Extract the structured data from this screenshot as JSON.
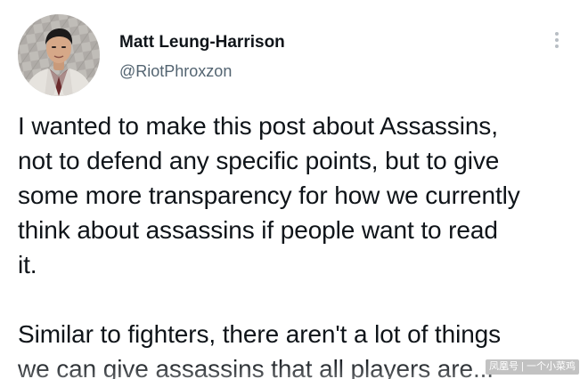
{
  "tweet": {
    "author": {
      "display_name": "Matt Leung-Harrison",
      "handle": "@RiotPhroxzon",
      "avatar_icon": "profile-photo"
    },
    "more_icon": "more-vertical-icon",
    "paragraphs": [
      "I wanted to make this post about Assassins,\nnot to defend any specific points, but to give\nsome more transparency for how we currently\nthink about assassins if people want to read\nit.",
      "Similar to fighters, there aren't a lot of things\nwe can give assassins that all players are..."
    ]
  },
  "watermark": {
    "text": "凤凰号 | 一个小菜鸡"
  },
  "colors": {
    "text_primary": "#0f1419",
    "text_secondary": "#536471",
    "more_dots": "#b8bec4",
    "background": "#ffffff"
  }
}
